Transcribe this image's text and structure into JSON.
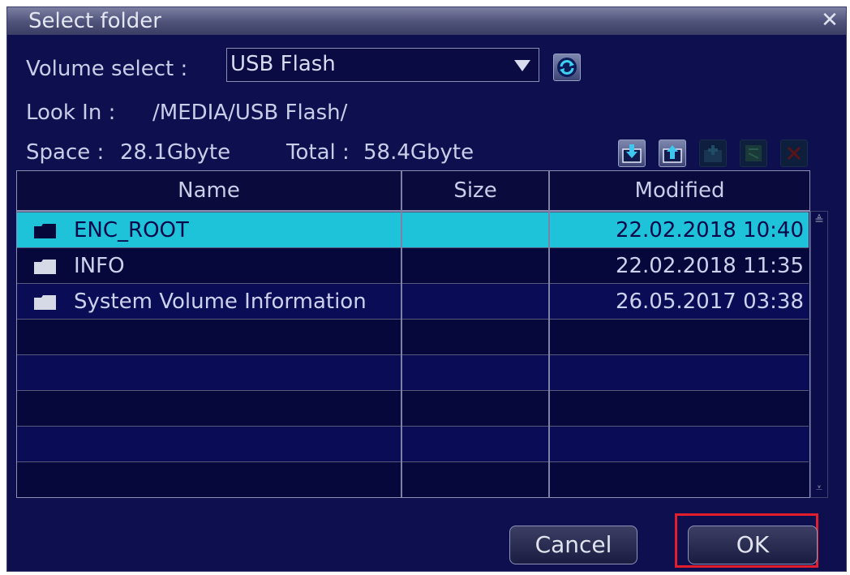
{
  "dialog": {
    "title": "Select folder",
    "close_glyph": "✕",
    "volume_label": "Volume select :",
    "volume_value": "USB Flash",
    "look_in_label": "Look In :",
    "look_in_path": "/MEDIA/USB Flash/",
    "space_label": "Space :",
    "space_value": "28.1Gbyte",
    "total_label": "Total :",
    "total_value": "58.4Gbyte"
  },
  "toolbar": {
    "icons": [
      "refresh-icon",
      "import-folder-icon",
      "upload-folder-icon",
      "new-folder-icon",
      "rename-icon",
      "delete-icon"
    ]
  },
  "table": {
    "columns": [
      "Name",
      "Size",
      "Modified"
    ],
    "rows": [
      {
        "name": "ENC_ROOT",
        "size": "",
        "modified": "22.02.2018 10:40",
        "selected": true
      },
      {
        "name": "INFO",
        "size": "",
        "modified": "22.02.2018 11:35",
        "selected": false
      },
      {
        "name": "System Volume Information",
        "size": "",
        "modified": "26.05.2017 03:38",
        "selected": false
      }
    ]
  },
  "buttons": {
    "cancel": "Cancel",
    "ok": "OK"
  },
  "colors": {
    "background": "#0e0f4e",
    "selection": "#1fc3d9",
    "highlight_outline": "#e21e2c"
  }
}
